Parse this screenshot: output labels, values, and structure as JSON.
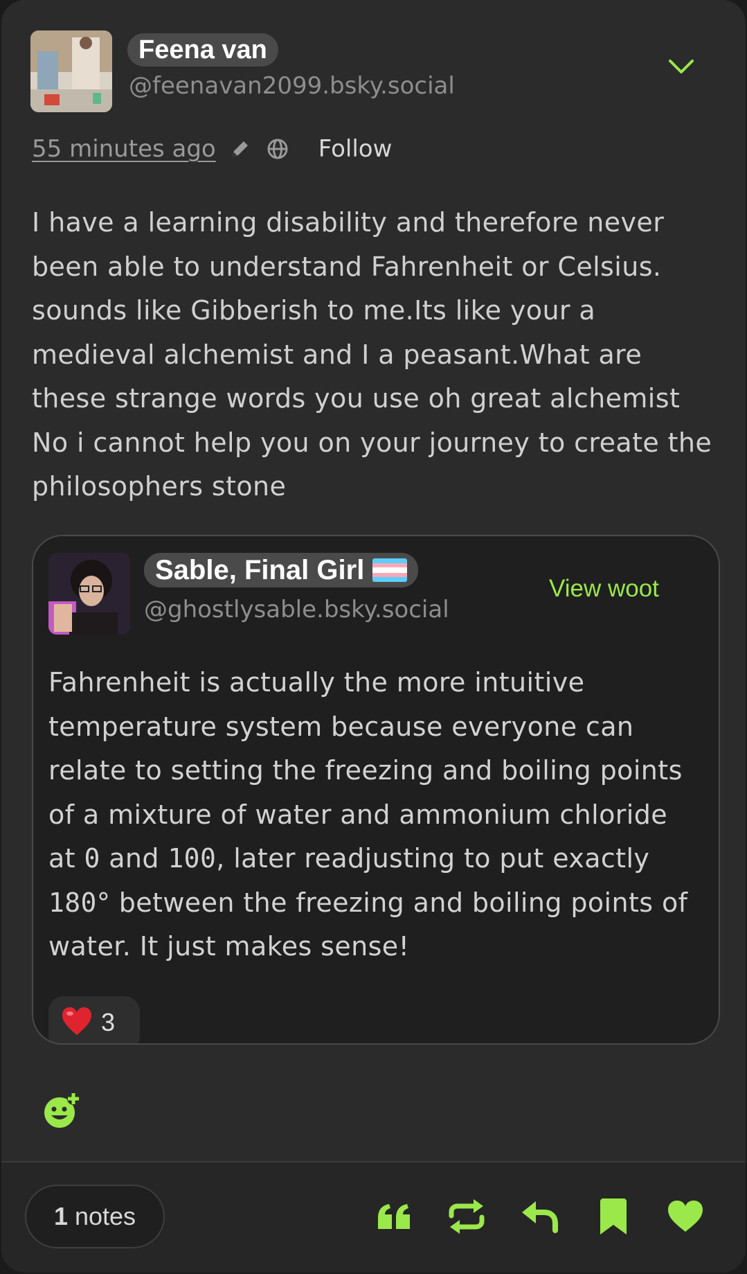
{
  "post": {
    "author": {
      "display_name": "Feena van",
      "handle": "@feenavan2099.bsky.social"
    },
    "timestamp": "55 minutes ago",
    "follow_label": "Follow",
    "text": "I have a learning disability and therefore never been able to understand Fahrenheit or Celsius. sounds like Gibberish to me.Its like your a medieval alchemist and I a peasant.What are these strange words you use oh great alchemist No i cannot help you on your journey to create the philosophers stone"
  },
  "quoted": {
    "author": {
      "display_name": "Sable, Final Girl",
      "handle": "@ghostlysable.bsky.social"
    },
    "view_label": "View woot",
    "text_part1": "Fahrenheit is actually the more intuitive temperature system because everyone can relate to setting the freezing and boiling points of a mixture of water and ammonium chloride at ",
    "num_zero": "0",
    "text_part2": " and ",
    "num_hundred": "100",
    "text_part3": ", later readjusting to put exactly ",
    "num_180": "180",
    "text_part4": "° between the freezing and boiling points of water. It just makes sense!",
    "reaction": {
      "emoji": "heart",
      "count": "3"
    }
  },
  "footer": {
    "notes_count": "1",
    "notes_label": "notes",
    "actions": [
      "quote-icon",
      "repost-icon",
      "reply-icon",
      "bookmark-icon",
      "like-icon"
    ]
  },
  "colors": {
    "accent": "#9be84a",
    "background": "#2b2b2b",
    "quote_background": "#1f1f1f"
  }
}
